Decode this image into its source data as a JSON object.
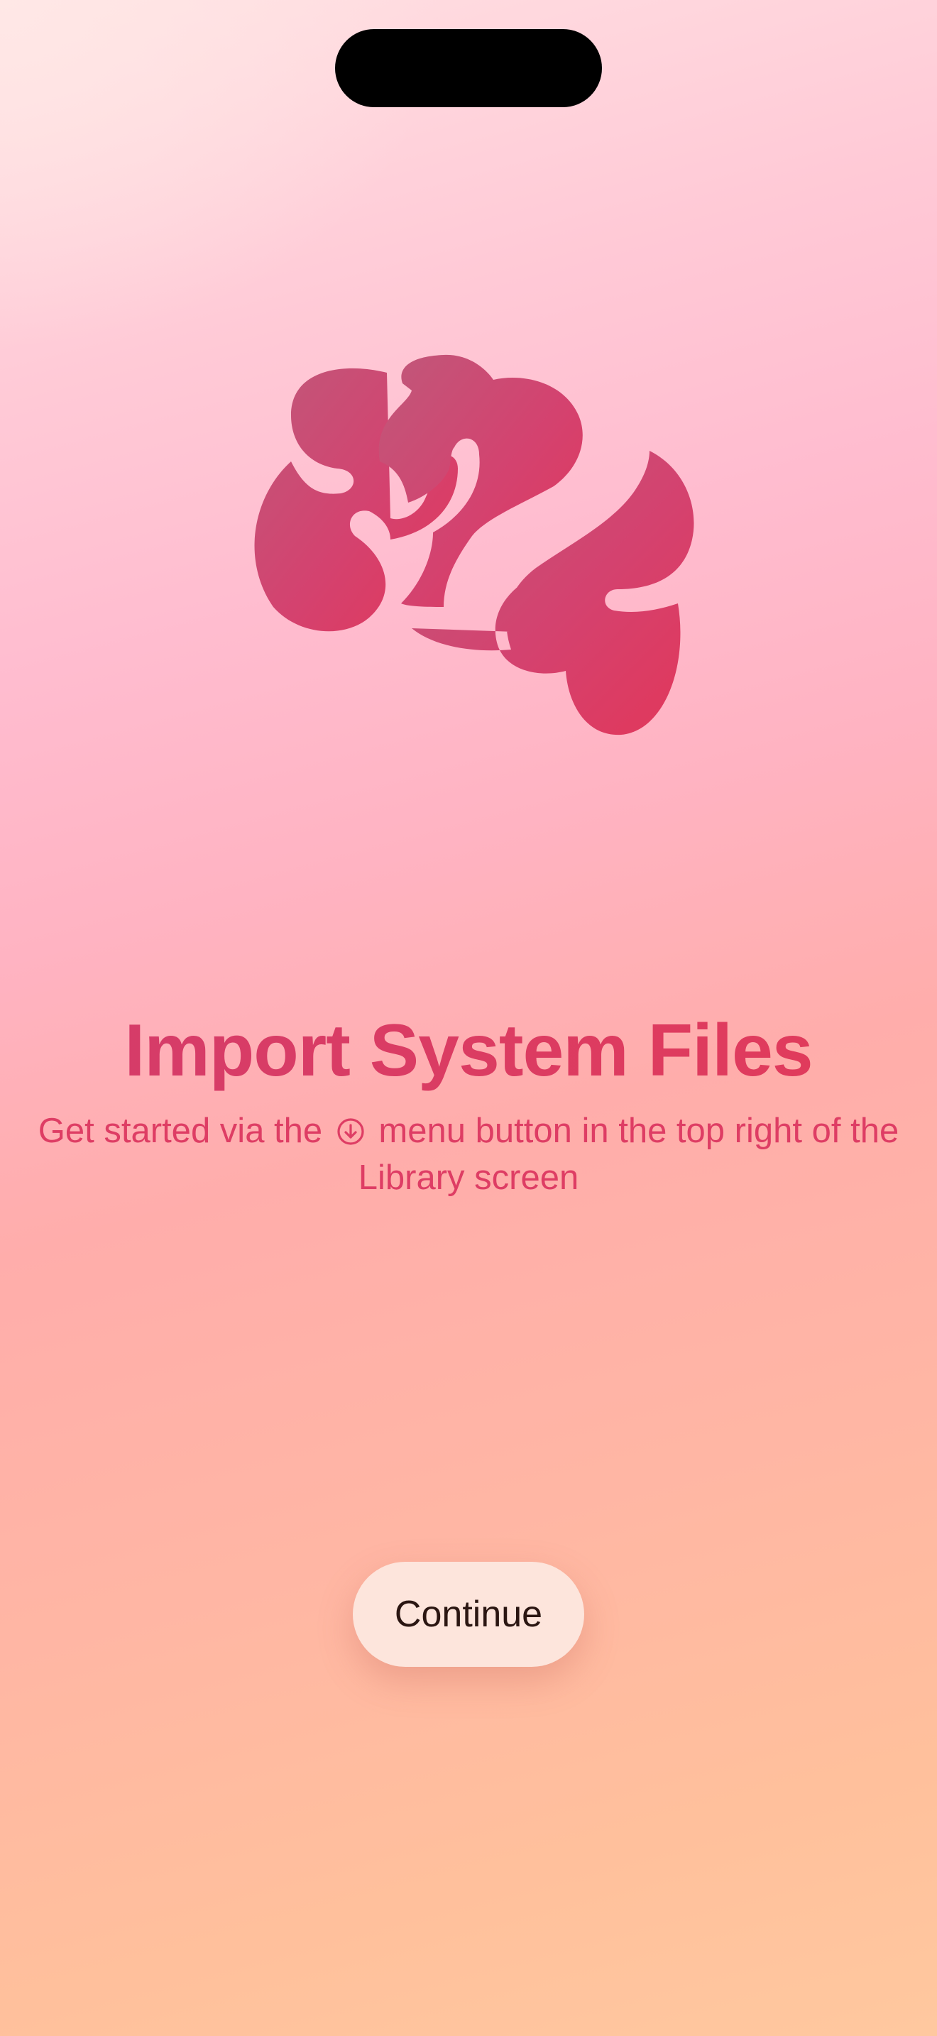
{
  "onboarding": {
    "hero_icon": "brain-icon",
    "title": "Import System Files",
    "subtitle_before_icon": "Get started via the",
    "subtitle_icon": "arrow-down-circle-icon",
    "subtitle_after_icon": "menu button in the top right of the Library screen",
    "continue_label": "Continue"
  },
  "colors": {
    "accent": "#d9406a",
    "title_gradient_start": "#d43c6b",
    "title_gradient_end": "#e23b5a",
    "button_background": "#fde5dc",
    "button_text": "#2b1612"
  }
}
